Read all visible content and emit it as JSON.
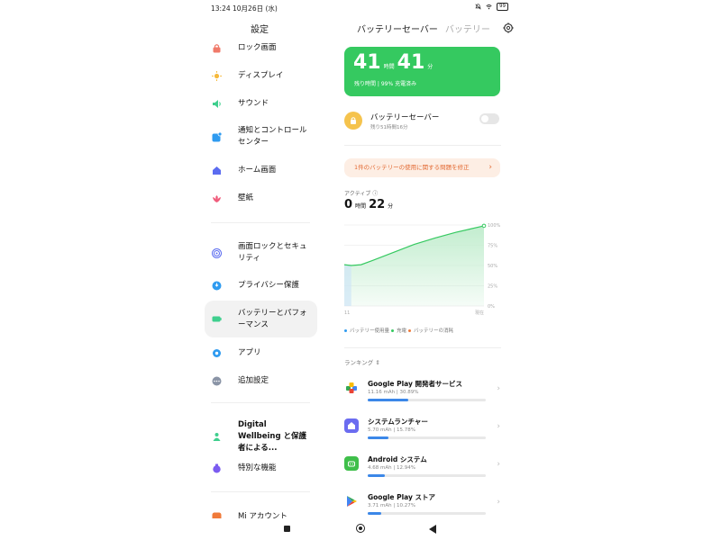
{
  "status_bar": {
    "time_date": "13:24  10月26日 (水)",
    "battery": "99"
  },
  "left": {
    "title": "設定",
    "items": [
      {
        "label": "ロック画面",
        "icon": "lock-icon",
        "color": "#f07a6a"
      },
      {
        "label": "ディスプレイ",
        "icon": "sun-icon",
        "color": "#f6b93b"
      },
      {
        "label": "サウンド",
        "icon": "speaker-icon",
        "color": "#3fcf8e"
      },
      {
        "label": "通知とコントロールセンター",
        "icon": "notification-icon",
        "color": "#2f9bf0"
      },
      {
        "label": "ホーム画面",
        "icon": "home-icon",
        "color": "#5b6cf0"
      },
      {
        "label": "壁紙",
        "icon": "flower-icon",
        "color": "#f05a7a"
      },
      {
        "label": "画面ロックとセキュリティ",
        "icon": "fingerprint-icon",
        "color": "#5b6cf0"
      },
      {
        "label": "プライバシー保護",
        "icon": "privacy-icon",
        "color": "#2f9bf0"
      },
      {
        "label": "バッテリーとパフォーマンス",
        "icon": "battery-icon",
        "color": "#3fcf8e"
      },
      {
        "label": "アプリ",
        "icon": "gear-icon",
        "color": "#2f9bf0"
      },
      {
        "label": "追加設定",
        "icon": "more-icon",
        "color": "#8a94a6"
      },
      {
        "label": "Digital Wellbeing と保護者による...",
        "icon": "wellbeing-icon",
        "color": "#3fcf8e"
      },
      {
        "label": "特別な機能",
        "icon": "special-icon",
        "color": "#7b5cf0"
      },
      {
        "label": "Mi アカウント",
        "icon": "mi-icon",
        "color": "#f07a3a"
      }
    ]
  },
  "right": {
    "tab_active": "バッテリーセーバー",
    "tab_inactive": "バッテリー",
    "remaining": {
      "hours": "41",
      "hours_unit": "時間",
      "minutes": "41",
      "minutes_unit": "分",
      "sub": "残り時間 | 99% 充電済み"
    },
    "saver": {
      "title": "バッテリーセーバー",
      "sub": "残り51時間16分",
      "enabled": false
    },
    "issue": "1件のバッテリーの使用に関する問題を修正",
    "active": {
      "label": "アクティブ ⓘ",
      "hours": "0",
      "hours_unit": "時間",
      "minutes": "22",
      "minutes_unit": "分"
    },
    "legend": [
      "バッテリー使用量",
      "充電",
      "バッテリーの消耗"
    ],
    "ranking_label": "ランキング ⇕",
    "apps": [
      {
        "name": "Google Play 開発者サービス",
        "meta": "11.16 mAh | 30.89%",
        "percent": 30.89,
        "icon": "play-services-icon",
        "color": "#ffffff"
      },
      {
        "name": "システムランチャー",
        "meta": "5.70 mAh | 15.78%",
        "percent": 15.78,
        "icon": "launcher-icon",
        "color": "#6b6cf0"
      },
      {
        "name": "Android システム",
        "meta": "4.68 mAh | 12.94%",
        "percent": 12.94,
        "icon": "android-icon",
        "color": "#3fbf4a"
      },
      {
        "name": "Google Play ストア",
        "meta": "3.71 mAh | 10.27%",
        "percent": 10.27,
        "icon": "play-store-icon",
        "color": "#ffffff"
      }
    ]
  },
  "chart_data": {
    "type": "area",
    "title": "",
    "x_ticks": [
      "11",
      "現在"
    ],
    "y_ticks": [
      "100%",
      "75%",
      "50%",
      "25%",
      "0%"
    ],
    "ylim": [
      0,
      100
    ],
    "x": [
      0,
      0.05,
      0.12,
      0.2,
      0.35,
      0.5,
      0.65,
      0.8,
      0.9,
      1.0
    ],
    "values": [
      51,
      50,
      51,
      56,
      66,
      76,
      84,
      91,
      95,
      99
    ],
    "colors": {
      "line": "#35c960",
      "fill": "#bfeccc",
      "low": "#cfe6f7"
    }
  },
  "colors": {
    "accent_green": "#35c960",
    "issue_bg": "#fdeee4",
    "issue_text": "#e36a33",
    "bar_blue": "#3b87e8"
  }
}
